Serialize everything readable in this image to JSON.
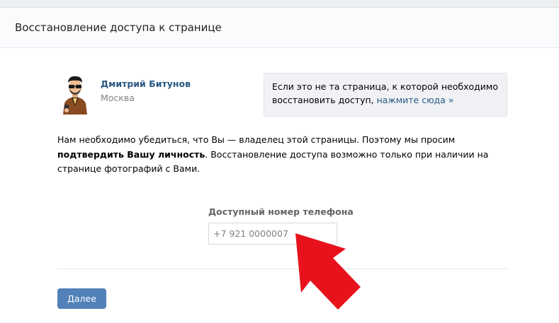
{
  "header": {
    "title": "Восстановление доступа к странице"
  },
  "profile": {
    "name": "Дмитрий Битунов",
    "city": "Москва"
  },
  "notice": {
    "text": "Если это не та страница, к которой необходимо восстановить доступ, ",
    "link": "нажмите сюда »"
  },
  "description": {
    "part1": "Нам необходимо убедиться, что Вы — владелец этой страницы. Поэтому мы просим ",
    "bold": "подтвердить Вашу личность",
    "part2": ". Восстановление доступа возможно только при наличии на странице фотографий с Вами."
  },
  "phone": {
    "label": "Доступный номер телефона",
    "value": "",
    "placeholder": "+7 921 0000007"
  },
  "actions": {
    "next_label": "Далее"
  },
  "colors": {
    "link": "#2a5885",
    "button": "#5181b8",
    "arrow": "#e8121c"
  },
  "icons": {
    "annotation": "red-arrow-icon",
    "avatar": "cartoon-avatar"
  }
}
